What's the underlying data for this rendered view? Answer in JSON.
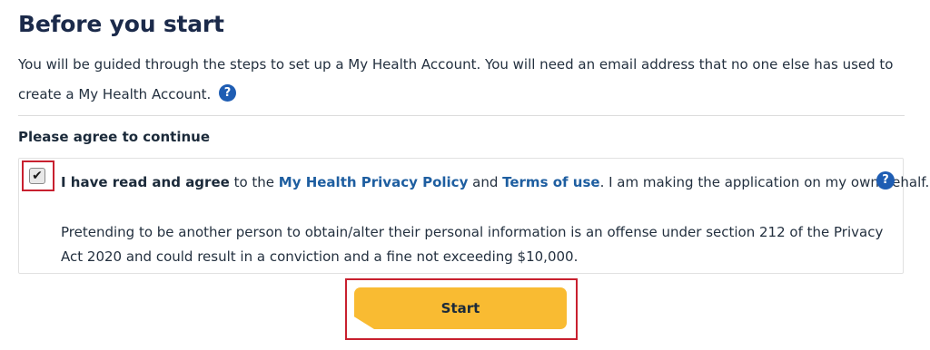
{
  "heading": "Before you start",
  "intro_text": "You will be guided through the steps to set up a My Health Account. You will need an email address that no one else has used to create a My Health Account.",
  "help_icon": "?",
  "section_label": "Please agree to continue",
  "agreement": {
    "checked_mark": "✔",
    "bold_prefix": "I have read and agree",
    "text_to_the": " to the ",
    "privacy_link": "My Health Privacy Policy",
    "text_and": " and ",
    "terms_link": "Terms of use",
    "text_after": ". I am making the application on my own behalf.",
    "legal_text": "Pretending to be another person to obtain/alter their personal information is an offense under section 212 of the Privacy Act 2020 and could result in a conviction and a fine not exceeding $10,000."
  },
  "start_button": "Start",
  "colors": {
    "accent_blue": "#1e5db3",
    "button_yellow": "#f9bb32",
    "highlight_red": "#c8202f"
  }
}
